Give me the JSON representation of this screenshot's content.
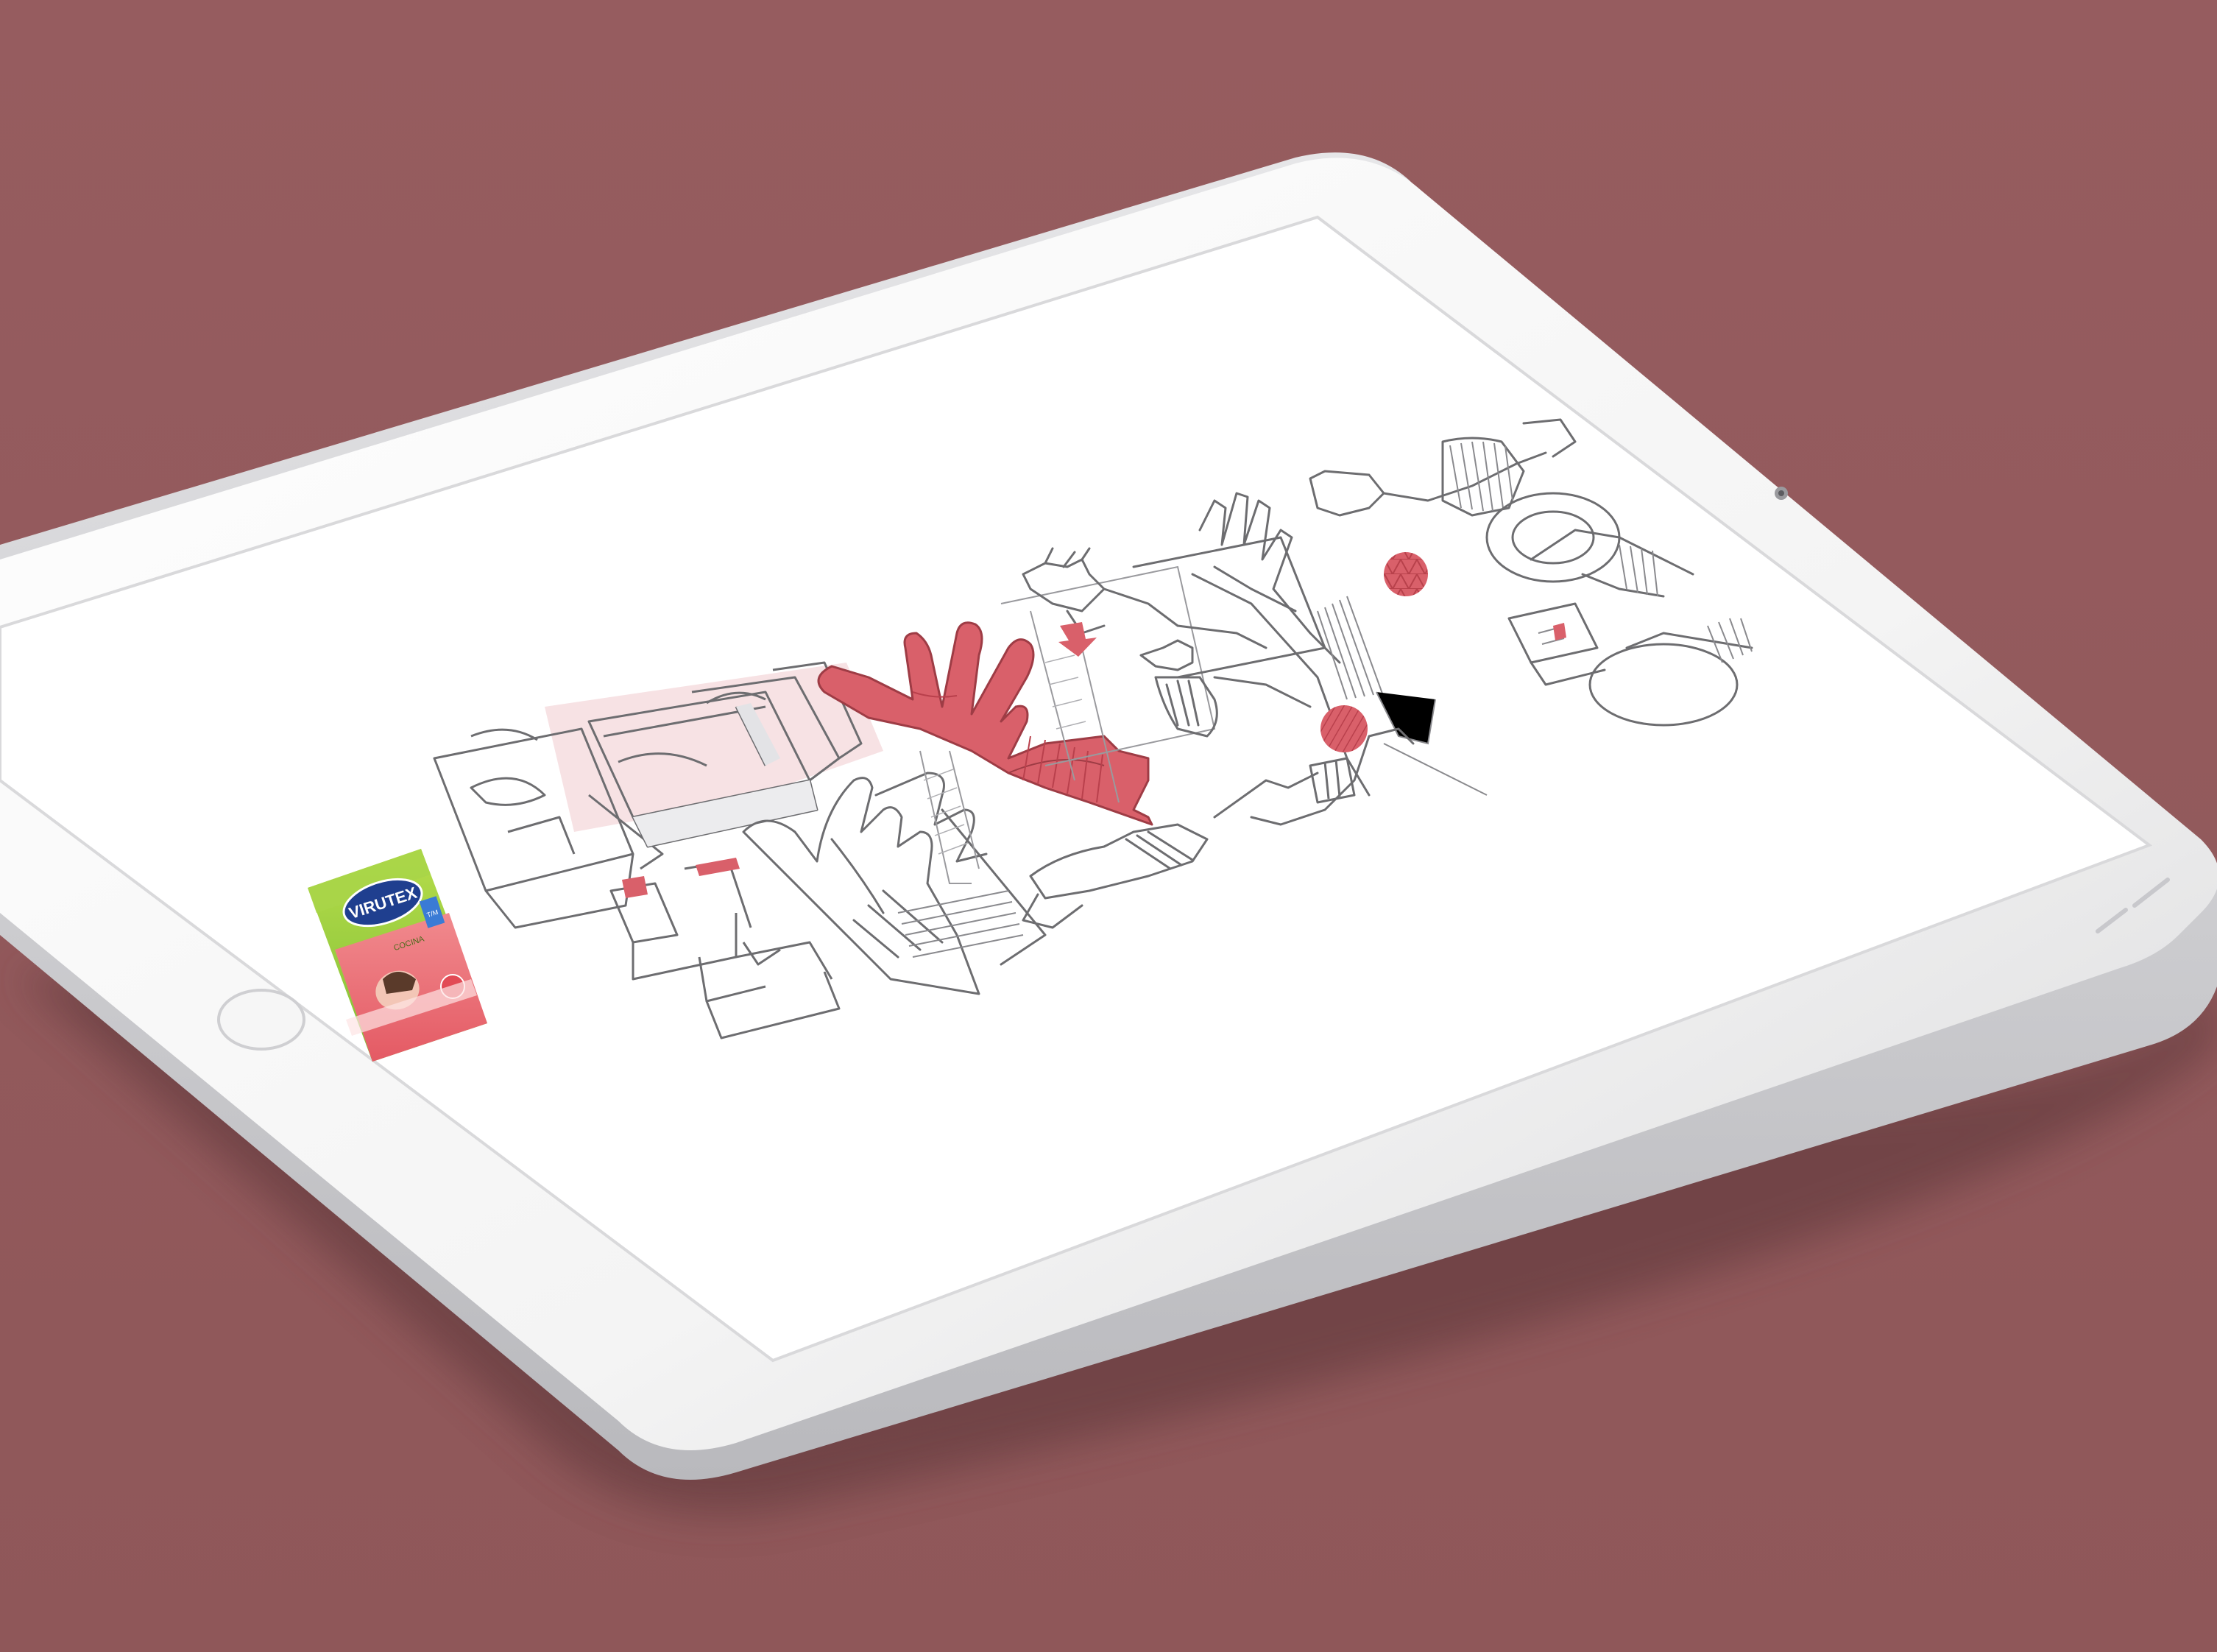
{
  "scene": {
    "background_color": "#935a5c",
    "device": "tablet-mockup",
    "device_color": "#ffffff",
    "accent_color": "#d9606a"
  },
  "package": {
    "brand": "VIRUTEX",
    "variant": "COCINA",
    "size_badge": "T/M",
    "colors": {
      "green": "#8cc63f",
      "blue": "#1f3f8f",
      "pink": "#e86a72"
    }
  },
  "illustrations": {
    "items": [
      "glove-package-sketch",
      "folded-package-sketch",
      "red-glove-drawing",
      "glove-outline-sketch",
      "hand-pulling-glove-sketch",
      "arrow-down-icon",
      "raised-hand-sketch",
      "textured-dot-icon",
      "striped-dot-icon",
      "dish-washing-sketch",
      "sponge-hand-sketch"
    ]
  }
}
